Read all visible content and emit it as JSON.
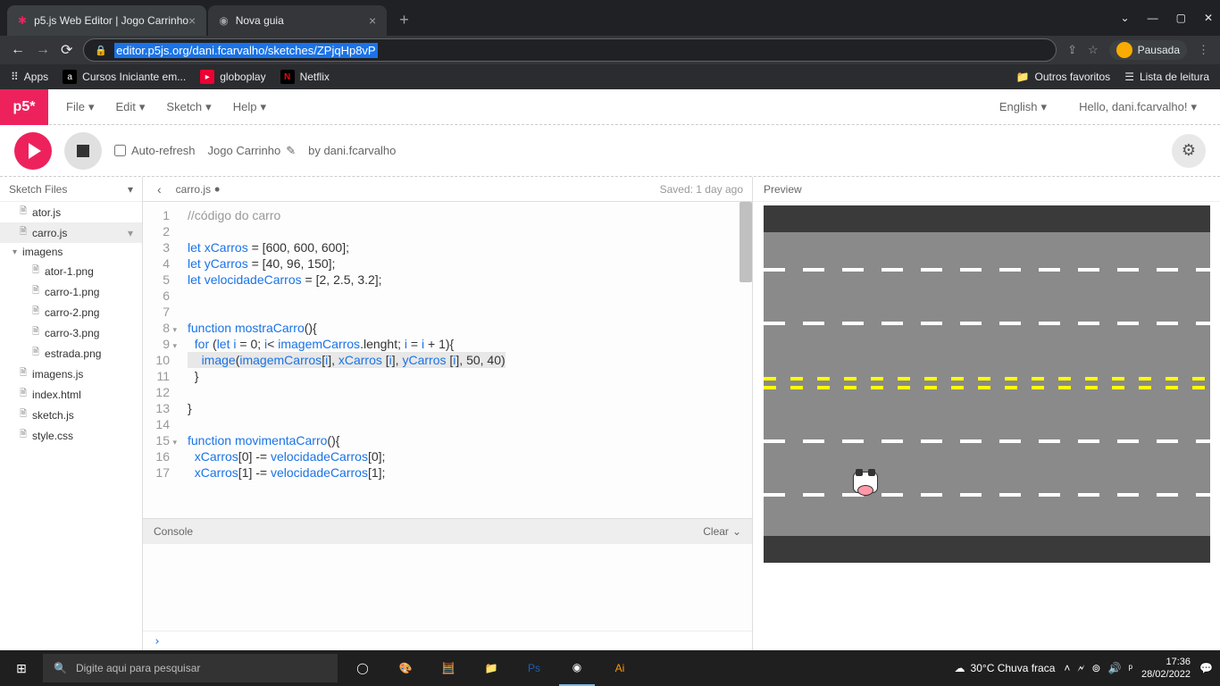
{
  "browser": {
    "tabs": [
      {
        "title": "p5.js Web Editor | Jogo Carrinho",
        "icon": "✱",
        "active": true
      },
      {
        "title": "Nova guia",
        "icon": "◔",
        "active": false
      }
    ],
    "url": "editor.p5js.org/dani.fcarvalho/sketches/ZPjqHp8vP",
    "profile_label": "Pausada",
    "bookmarks": {
      "apps": "Apps",
      "items": [
        {
          "label": "Cursos Iniciante em...",
          "icon": "a",
          "bg": "#000"
        },
        {
          "label": "globoplay",
          "icon": "▶",
          "bg": "#e03"
        },
        {
          "label": "Netflix",
          "icon": "N",
          "bg": "#e50914"
        }
      ],
      "right": [
        {
          "label": "Outros favoritos",
          "icon": "📁"
        },
        {
          "label": "Lista de leitura",
          "icon": "☰"
        }
      ]
    }
  },
  "p5": {
    "logo": "p5*",
    "menu": [
      "File",
      "Edit",
      "Sketch",
      "Help"
    ],
    "lang": "English",
    "greeting": "Hello, dani.fcarvalho!",
    "auto_refresh": "Auto-refresh",
    "sketch_name": "Jogo Carrinho",
    "by_label": "by dani.fcarvalho",
    "sidebar_title": "Sketch Files",
    "files": [
      {
        "name": "ator.js",
        "type": "file"
      },
      {
        "name": "carro.js",
        "type": "file",
        "selected": true
      },
      {
        "name": "imagens",
        "type": "folder"
      },
      {
        "name": "ator-1.png",
        "type": "nested"
      },
      {
        "name": "carro-1.png",
        "type": "nested"
      },
      {
        "name": "carro-2.png",
        "type": "nested"
      },
      {
        "name": "carro-3.png",
        "type": "nested"
      },
      {
        "name": "estrada.png",
        "type": "nested"
      },
      {
        "name": "imagens.js",
        "type": "file"
      },
      {
        "name": "index.html",
        "type": "file"
      },
      {
        "name": "sketch.js",
        "type": "file"
      },
      {
        "name": "style.css",
        "type": "file"
      }
    ],
    "current_file": "carro.js",
    "saved": "Saved: 1 day ago",
    "code_lines": [
      {
        "n": 1,
        "html": "<span class='cmt'>//código do carro</span>"
      },
      {
        "n": 2,
        "html": ""
      },
      {
        "n": 3,
        "html": "<span class='kw'>let</span> <span class='var'>xCarros</span> = [<span class='num'>600</span>, <span class='num'>600</span>, <span class='num'>600</span>];"
      },
      {
        "n": 4,
        "html": "<span class='kw'>let</span> <span class='var'>yCarros</span> = [<span class='num'>40</span>, <span class='num'>96</span>, <span class='num'>150</span>];"
      },
      {
        "n": 5,
        "html": "<span class='kw'>let</span> <span class='var'>velocidadeCarros</span> = [<span class='num'>2</span>, <span class='num'>2.5</span>, <span class='num'>3.2</span>];"
      },
      {
        "n": 6,
        "html": ""
      },
      {
        "n": 7,
        "html": ""
      },
      {
        "n": 8,
        "fold": true,
        "html": "<span class='kw'>function</span> <span class='fn'>mostraCarro</span>(){"
      },
      {
        "n": 9,
        "fold": true,
        "html": "  <span class='kw'>for</span> (<span class='kw'>let</span> <span class='var'>i</span> = <span class='num'>0</span>; <span class='var'>i</span>&lt; <span class='var'>imagemCarros</span>.lenght; <span class='var'>i</span> = <span class='var'>i</span> + <span class='num'>1</span>){"
      },
      {
        "n": 10,
        "hl": true,
        "html": "    <span class='fn'>image</span>(<span class='var'>imagemCarros</span>[<span class='var'>i</span>], <span class='var'>xCarros</span> [<span class='var'>i</span>], <span class='var'>yCarros</span> [<span class='var'>i</span>], <span class='num'>50</span>, <span class='num'>40</span>)"
      },
      {
        "n": 11,
        "html": "  }"
      },
      {
        "n": 12,
        "html": ""
      },
      {
        "n": 13,
        "html": "}"
      },
      {
        "n": 14,
        "html": ""
      },
      {
        "n": 15,
        "fold": true,
        "html": "<span class='kw'>function</span> <span class='fn'>movimentaCarro</span>(){"
      },
      {
        "n": 16,
        "html": "  <span class='var'>xCarros</span>[<span class='num'>0</span>] -= <span class='var'>velocidadeCarros</span>[<span class='num'>0</span>];"
      },
      {
        "n": 17,
        "html": "  <span class='var'>xCarros</span>[<span class='num'>1</span>] -= <span class='var'>velocidadeCarros</span>[<span class='num'>1</span>];"
      }
    ],
    "console_label": "Console",
    "clear_label": "Clear",
    "preview_label": "Preview"
  },
  "taskbar": {
    "search_placeholder": "Digite aqui para pesquisar",
    "weather": "30°C  Chuva fraca",
    "time": "17:36",
    "date": "28/02/2022"
  }
}
